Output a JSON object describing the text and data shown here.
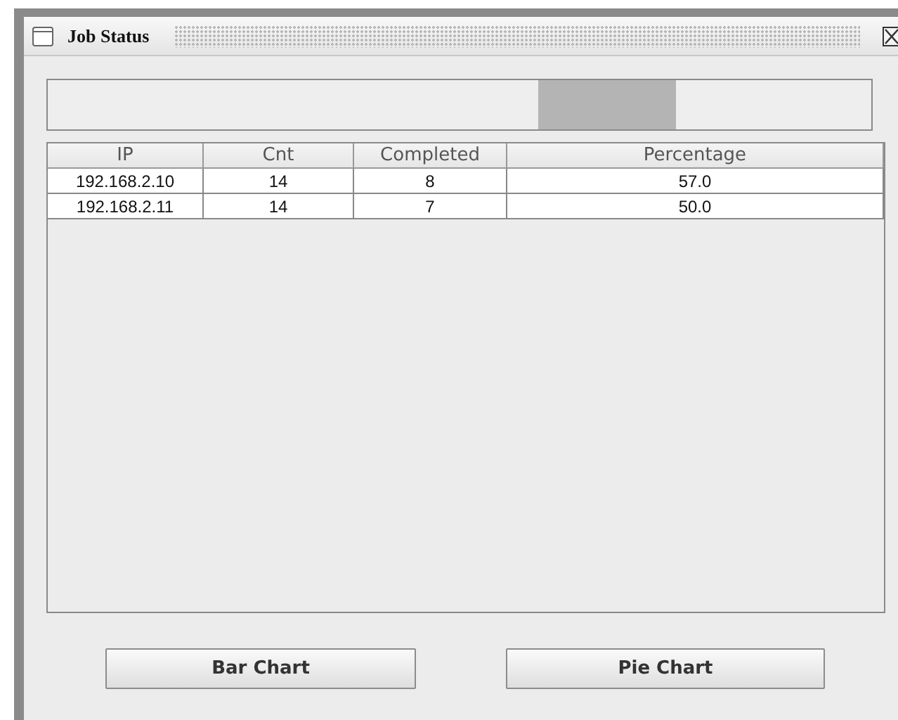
{
  "window": {
    "title": "Job Status"
  },
  "progress": {
    "indeterminate": true
  },
  "table": {
    "columns": [
      "IP",
      "Cnt",
      "Completed",
      "Percentage"
    ],
    "rows": [
      [
        "192.168.2.10",
        "14",
        "8",
        "57.0"
      ],
      [
        "192.168.2.11",
        "14",
        "7",
        "50.0"
      ]
    ]
  },
  "buttons": [
    "Bar Chart",
    "Pie Chart"
  ]
}
